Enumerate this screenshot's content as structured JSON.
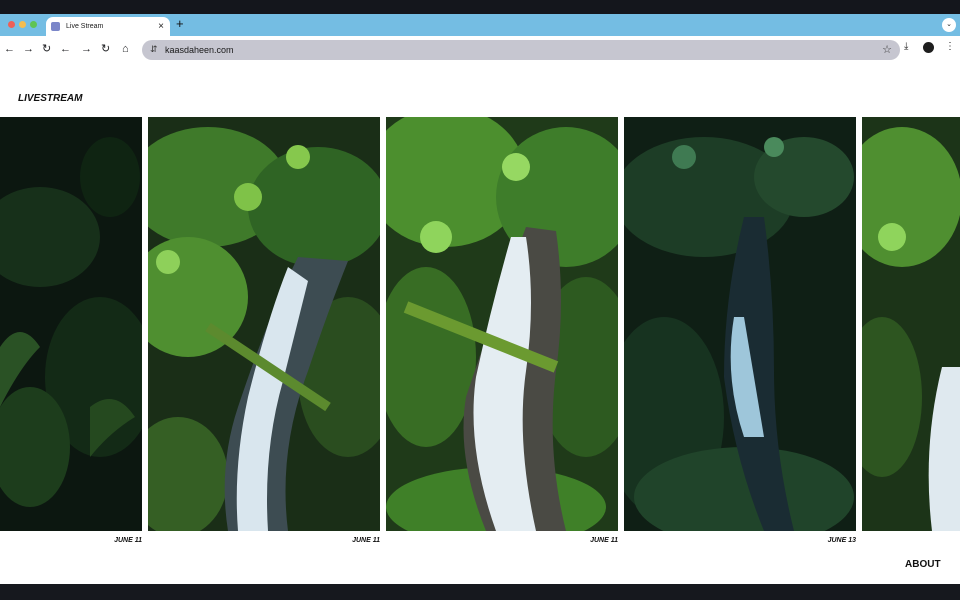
{
  "browser": {
    "tab_title": "Live Stream",
    "url": "kaasdaheen.com",
    "accent": "#74bde3"
  },
  "site": {
    "logo_prefix": "LIVE",
    "logo_suffix": "STREAM",
    "about_label": "ABOUT",
    "captions": [
      {
        "month": "JUNE",
        "day": "11"
      },
      {
        "month": "JUNE",
        "day": "11"
      },
      {
        "month": "JUNE",
        "day": "11"
      },
      {
        "month": "JUNE",
        "day": "13"
      }
    ]
  }
}
